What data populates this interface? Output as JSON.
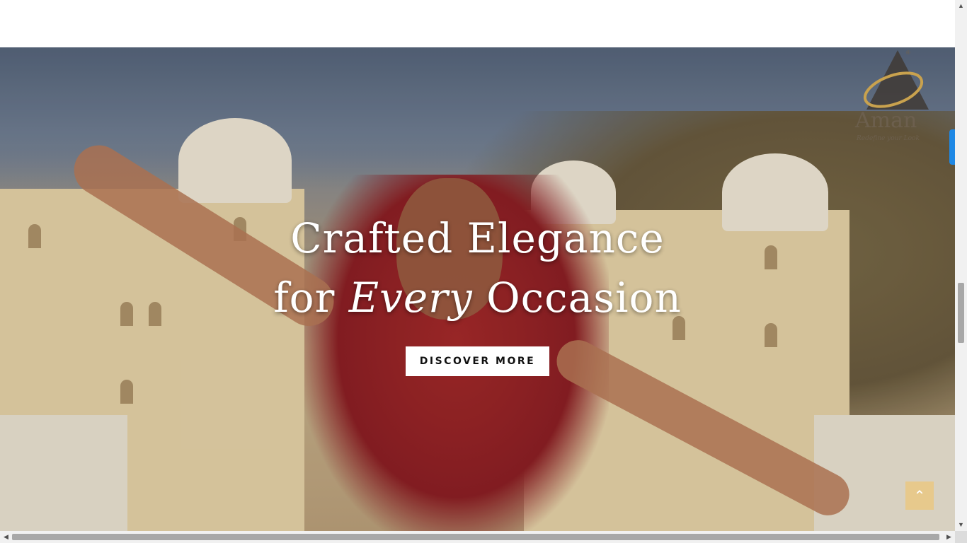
{
  "hero": {
    "headline_line1": "Crafted Elegance",
    "headline_line2_prefix": "for ",
    "headline_line2_em": "Every",
    "headline_line2_suffix": " Occasion",
    "cta_label": "DISCOVER MORE"
  },
  "logo": {
    "name": "Aman",
    "tagline": "Redefine your Look",
    "registered_mark": "®"
  },
  "scroll_to_top": {
    "icon": "chevron-up-icon",
    "glyph": "⌃"
  },
  "colors": {
    "cta_background": "#ffffff",
    "scroll_top_button": "#e7c98c",
    "side_tab": "#1e88e5",
    "logo_ring": "#c9a24e"
  }
}
